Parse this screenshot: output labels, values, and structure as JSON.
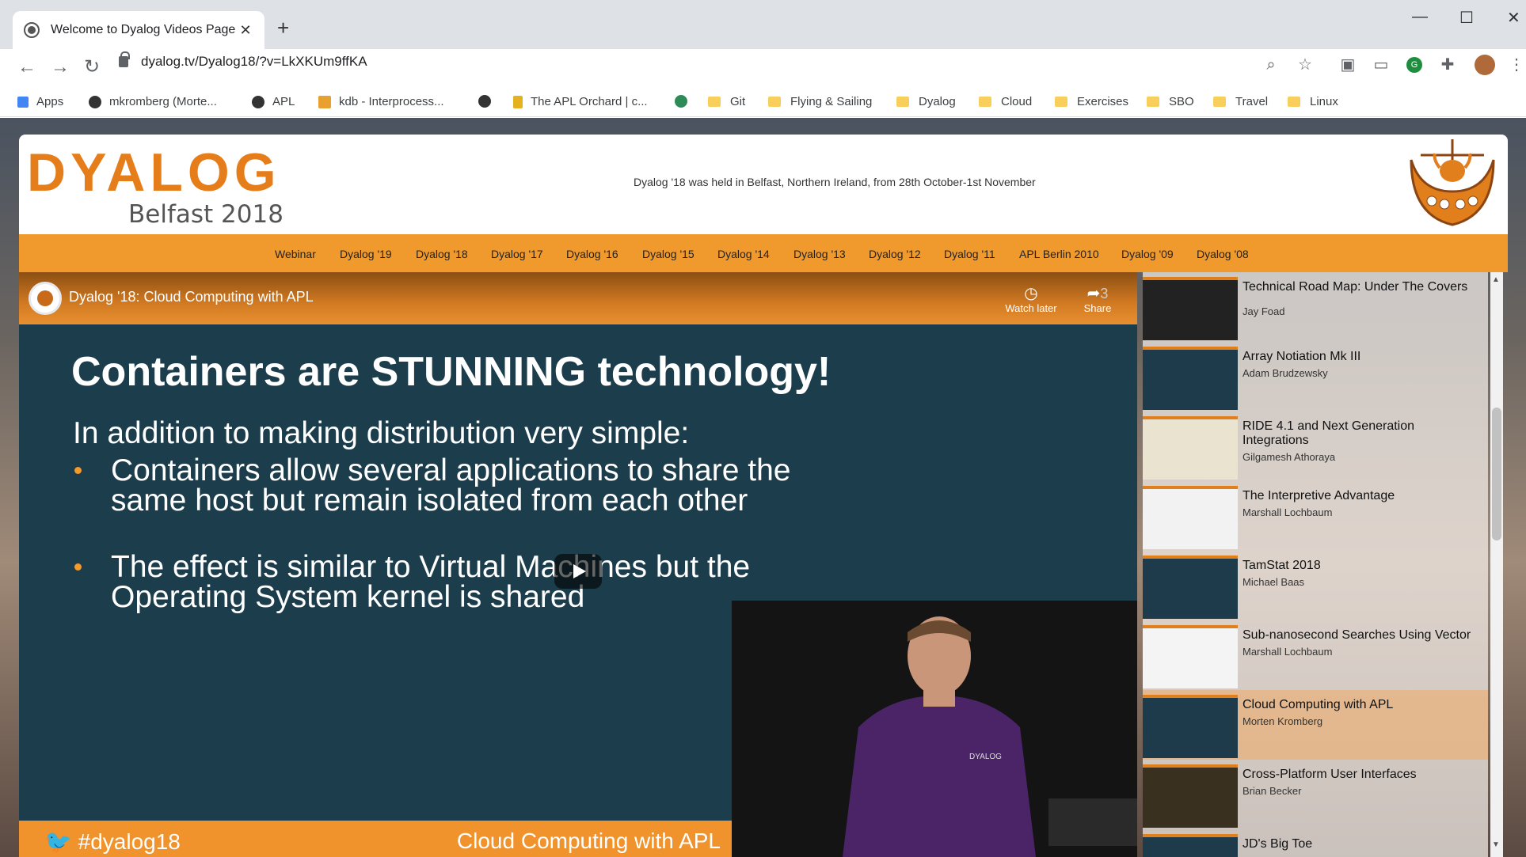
{
  "browser": {
    "tab_title": "Welcome to Dyalog Videos Page",
    "url": "dyalog.tv/Dyalog18/?v=LkXKUm9ffKA",
    "bookmarks": [
      "Apps",
      "mkromberg (Morte...",
      "APL",
      "kdb - Interprocess...",
      "The APL Orchard | c...",
      "Git",
      "Flying & Sailing",
      "Dyalog",
      "Cloud",
      "Exercises",
      "SBO",
      "Travel",
      "Linux"
    ]
  },
  "header": {
    "logo": "DYALOG",
    "event": "Belfast 2018",
    "tagline": "Dyalog '18 was held in Belfast, Northern Ireland, from 28th October-1st November"
  },
  "nav": [
    "Webinar",
    "Dyalog '19",
    "Dyalog '18",
    "Dyalog '17",
    "Dyalog '16",
    "Dyalog '15",
    "Dyalog '14",
    "Dyalog '13",
    "Dyalog '12",
    "Dyalog '11",
    "APL Berlin 2010",
    "Dyalog '09",
    "Dyalog '08"
  ],
  "video": {
    "title": "Dyalog '18: Cloud Computing with APL",
    "watch_later": "Watch later",
    "share": "Share",
    "share_count": "3",
    "slide_heading": "Containers are STUNNING technology!",
    "slide_intro": "In addition to making distribution very simple:",
    "bullets": [
      "Containers allow several applications to share the same host but remain isolated from each other",
      "The effect is similar to Virtual Machines but the Operating System kernel is shared"
    ],
    "footer_tag": "#dyalog18",
    "footer_title": "Cloud Computing with APL"
  },
  "playlist": [
    {
      "title": "Technical Road Map: Under The Covers",
      "author": "Jay Foad"
    },
    {
      "title": "Array Notiation Mk III",
      "author": "Adam Brudzewsky"
    },
    {
      "title": "RIDE 4.1 and Next Generation Integrations",
      "author": "Gilgamesh Athoraya"
    },
    {
      "title": "The Interpretive Advantage",
      "author": "Marshall Lochbaum"
    },
    {
      "title": "TamStat 2018",
      "author": "Michael Baas"
    },
    {
      "title": "Sub-nanosecond Searches Using Vector",
      "author": "Marshall Lochbaum"
    },
    {
      "title": "Cloud Computing with APL",
      "author": "Morten Kromberg"
    },
    {
      "title": "Cross-Platform User Interfaces",
      "author": "Brian Becker"
    },
    {
      "title": "JD's Big Toe",
      "author": ""
    }
  ]
}
